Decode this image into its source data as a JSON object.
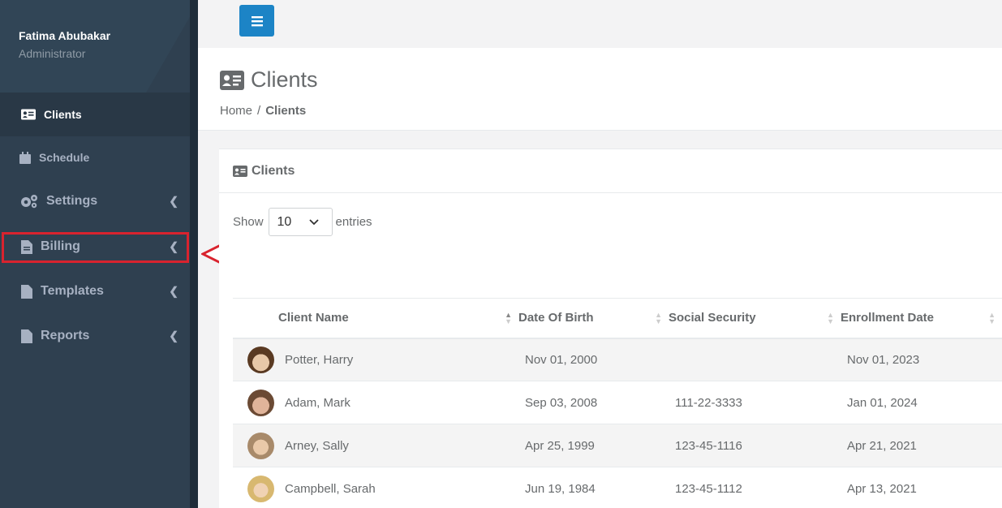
{
  "profile": {
    "name": "Fatima Abubakar",
    "role": "Administrator"
  },
  "sidebar": {
    "items": [
      {
        "label": "Clients",
        "icon": "id-card-icon"
      },
      {
        "label": "Schedule",
        "icon": "calendar-icon"
      },
      {
        "label": "Settings",
        "icon": "gears-icon"
      },
      {
        "label": "Billing",
        "icon": "document-icon"
      },
      {
        "label": "Templates",
        "icon": "document-icon"
      },
      {
        "label": "Reports",
        "icon": "document-icon"
      }
    ]
  },
  "header": {
    "title": "Clients",
    "breadcrumb": {
      "home": "Home",
      "separator": "/",
      "current": "Clients"
    }
  },
  "card": {
    "title": "Clients",
    "show_label": "Show",
    "entries_value": "10",
    "entries_label": "entries"
  },
  "table": {
    "columns": [
      "Client Name",
      "Date Of Birth",
      "Social Security",
      "Enrollment Date"
    ],
    "rows": [
      {
        "name": "Potter, Harry",
        "dob": "Nov 01, 2000",
        "ssn": "",
        "enrollment": "Nov 01, 2023",
        "avatar_color": "#c89a6a"
      },
      {
        "name": "Adam, Mark",
        "dob": "Sep 03, 2008",
        "ssn": "111-22-3333",
        "enrollment": "Jan 01, 2024",
        "avatar_color": "#b88a70"
      },
      {
        "name": "Arney, Sally",
        "dob": "Apr 25, 1999",
        "ssn": "123-45-1116",
        "enrollment": "Apr 21, 2021",
        "avatar_color": "#c9b29a"
      },
      {
        "name": "Campbell, Sarah",
        "dob": "Jun 19, 1984",
        "ssn": "123-45-1112",
        "enrollment": "Apr 13, 2021",
        "avatar_color": "#d9c08a"
      }
    ]
  },
  "colors": {
    "sidebar": "#2f4050",
    "primary": "#1c84c6",
    "highlight": "#d9232e"
  }
}
